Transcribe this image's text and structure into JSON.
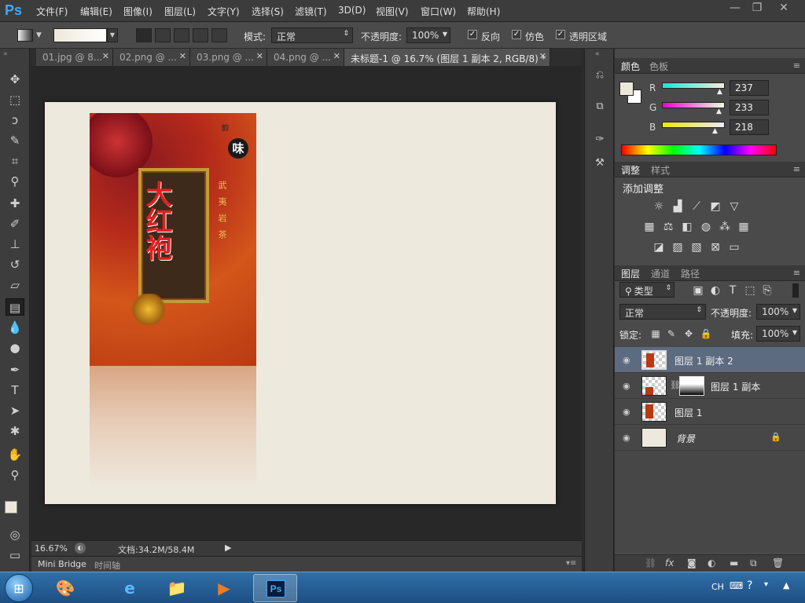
{
  "app": {
    "logo": "Ps"
  },
  "menu": [
    "文件(F)",
    "编辑(E)",
    "图像(I)",
    "图层(L)",
    "文字(Y)",
    "选择(S)",
    "滤镜(T)",
    "3D(D)",
    "视图(V)",
    "窗口(W)",
    "帮助(H)"
  ],
  "options": {
    "mode_label": "模式:",
    "mode_value": "正常",
    "opacity_label": "不透明度:",
    "opacity_value": "100%",
    "reverse_label": "反向",
    "dither_label": "仿色",
    "transparency_label": "透明区域"
  },
  "tabs": [
    {
      "label": "01.jpg @ 8..."
    },
    {
      "label": "02.png @ ..."
    },
    {
      "label": "03.png @ ..."
    },
    {
      "label": "04.png @ ..."
    },
    {
      "label": "未标题-1 @ 16.7% (图层 1 副本 2, RGB/8) *"
    }
  ],
  "poster": {
    "title": "大红袍",
    "side_text": "武夷岩茶",
    "small_text": "韵"
  },
  "status": {
    "zoom": "16.67%",
    "doc": "文档:34.2M/58.4M"
  },
  "bottom_tabs": [
    "Mini Bridge",
    "时间轴"
  ],
  "color_panel": {
    "tabs": [
      "颜色",
      "色板"
    ],
    "r_label": "R",
    "g_label": "G",
    "b_label": "B",
    "r": "237",
    "g": "233",
    "b": "218"
  },
  "adjust_panel": {
    "tabs": [
      "调整",
      "样式"
    ],
    "heading": "添加调整"
  },
  "layers_panel": {
    "tabs": [
      "图层",
      "通道",
      "路径"
    ],
    "filter_label": "类型",
    "blend_mode": "正常",
    "opacity_label": "不透明度:",
    "opacity_value": "100%",
    "lock_label": "锁定:",
    "fill_label": "填充:",
    "fill_value": "100%",
    "layers": [
      {
        "name": "图层 1 副本 2"
      },
      {
        "name": "图层 1 副本"
      },
      {
        "name": "图层 1"
      },
      {
        "name": "背景"
      }
    ]
  },
  "taskbar": {
    "lang": "CH"
  },
  "colors": {
    "accent": "#3fa9f5",
    "selection": "#5c6b80",
    "foreground": "#ede9da"
  }
}
